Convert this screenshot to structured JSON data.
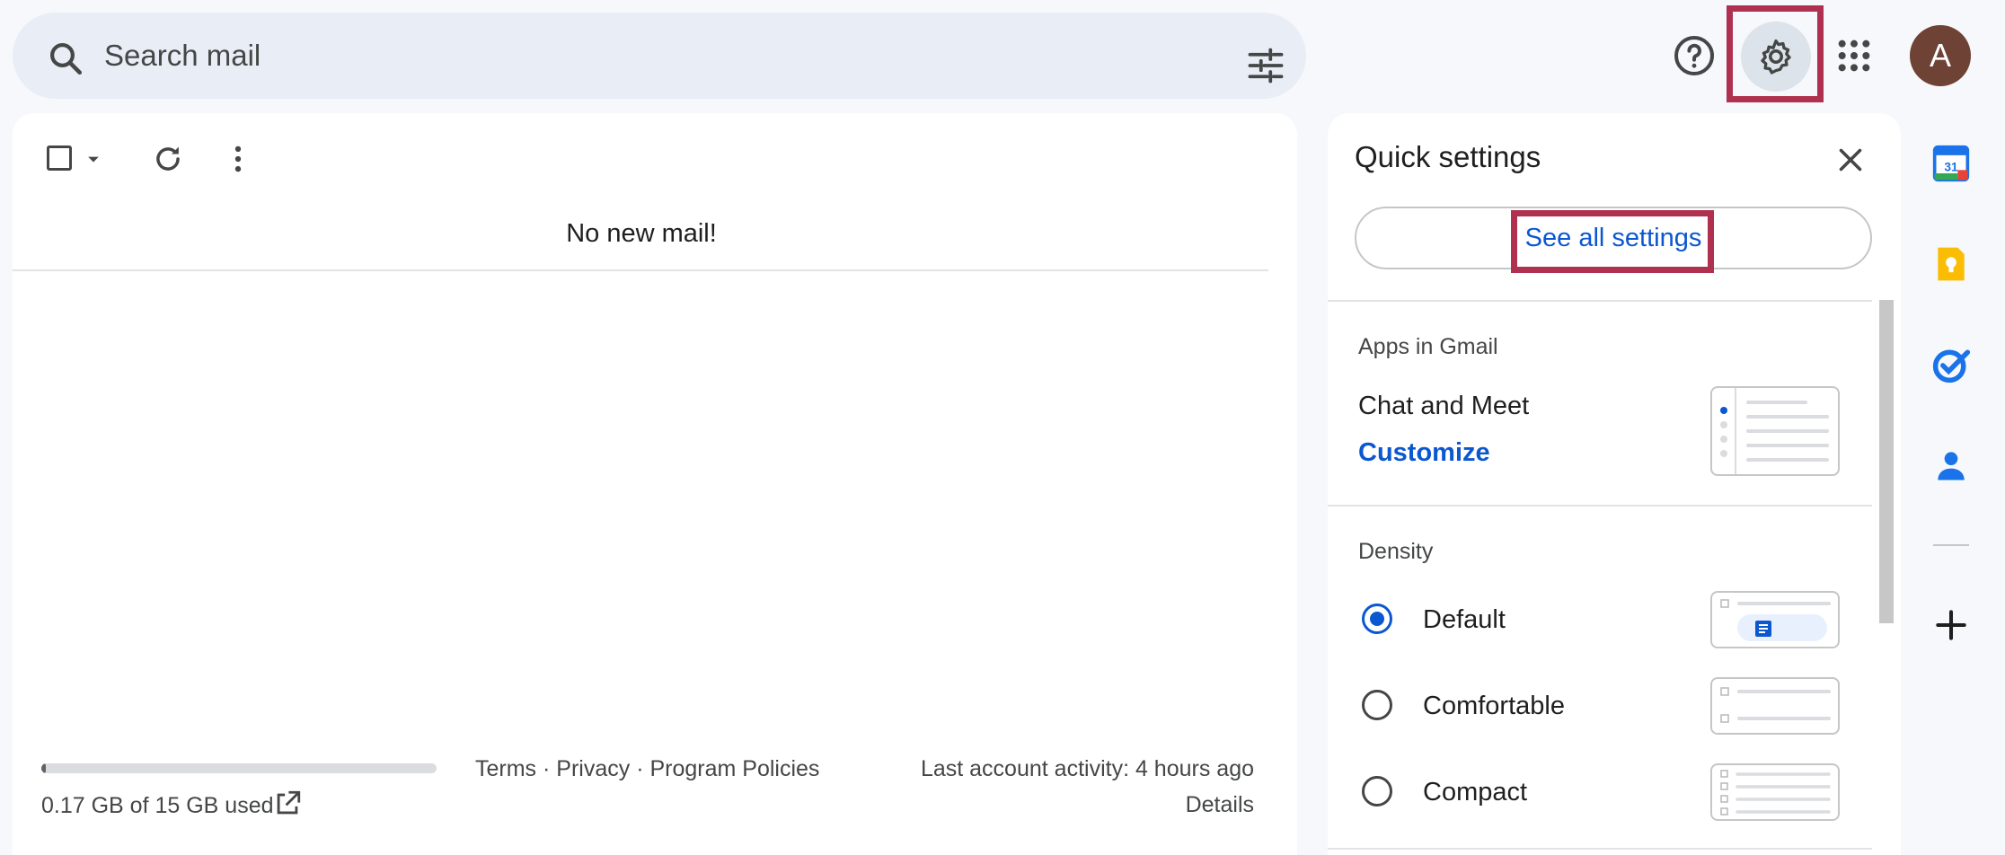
{
  "search": {
    "placeholder": "Search mail"
  },
  "header": {
    "avatar_letter": "A"
  },
  "mail": {
    "empty_message": "No new mail!",
    "storage": {
      "text": "0.17 GB of 15 GB used",
      "used_fraction": 0.011
    },
    "footer": {
      "terms": "Terms",
      "privacy": "Privacy",
      "policies": "Program Policies",
      "sep": " · "
    },
    "activity": "Last account activity: 4 hours ago",
    "details": "Details"
  },
  "quick_settings": {
    "title": "Quick settings",
    "see_all": "See all settings",
    "apps_section": "Apps in Gmail",
    "chat_meet": "Chat and Meet",
    "customize": "Customize",
    "density_section": "Density",
    "density_options": [
      "Default",
      "Comfortable",
      "Compact"
    ],
    "density_selected": "Default"
  },
  "colors": {
    "accent": "#0b57d0",
    "highlight": "#b0304f",
    "avatar_bg": "#6e4235"
  }
}
